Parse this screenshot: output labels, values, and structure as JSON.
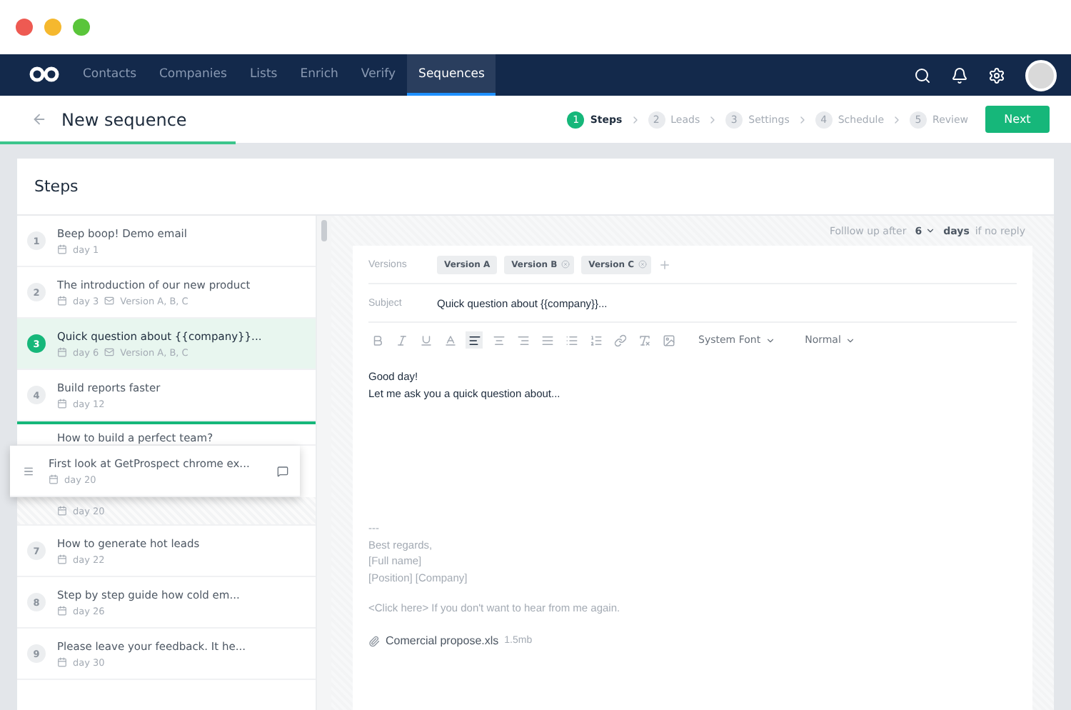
{
  "nav": {
    "tabs": [
      {
        "label": "Contacts",
        "selected": false
      },
      {
        "label": "Companies",
        "selected": false
      },
      {
        "label": "Lists",
        "selected": false
      },
      {
        "label": "Enrich",
        "selected": false
      },
      {
        "label": "Verify",
        "selected": false
      },
      {
        "label": "Sequences",
        "selected": true
      }
    ]
  },
  "header": {
    "title": "New sequence",
    "progress": {
      "level": 0.22
    },
    "wizard": [
      {
        "number": "1",
        "label": "Steps",
        "selected": true
      },
      {
        "number": "2",
        "label": "Leads",
        "selected": false
      },
      {
        "number": "3",
        "label": "Settings",
        "selected": false
      },
      {
        "number": "4",
        "label": "Schedule",
        "selected": false
      },
      {
        "number": "5",
        "label": "Review",
        "selected": false
      }
    ],
    "next_button": "Next"
  },
  "panel_title": "Steps",
  "steps": [
    {
      "kind": "step",
      "number": "1",
      "title": "Beep boop! Demo email",
      "day": "day 1",
      "selected": false
    },
    {
      "kind": "step",
      "number": "2",
      "title": "The introduction of our new product",
      "day": "day 3",
      "versions": "Version A, B, C",
      "selected": false
    },
    {
      "kind": "step",
      "number": "3",
      "title": "Quick question about {{company}}...",
      "day": "day 6",
      "versions": "Version A, B, C",
      "selected": true
    },
    {
      "kind": "step",
      "number": "4",
      "title": "Build reports faster",
      "day": "day 12",
      "selected": false
    },
    {
      "kind": "drop-target",
      "title": "How to build a perfect team?",
      "selected": false
    },
    {
      "kind": "dragged",
      "title": "First look at GetProspect chrome ex...",
      "day": "day 20",
      "selected": false
    },
    {
      "kind": "ghost",
      "day": "day 20",
      "selected": false
    },
    {
      "kind": "step",
      "number": "7",
      "title": "How to generate hot leads",
      "day": "day 22",
      "selected": false
    },
    {
      "kind": "step",
      "number": "8",
      "title": "Step by step guide how cold em...",
      "day": "day 26",
      "selected": false
    },
    {
      "kind": "step",
      "number": "9",
      "title": "Please leave your feedback. It he...",
      "day": "day 30",
      "selected": false
    }
  ],
  "follow_up": {
    "prefix": "Folllow up after",
    "value": "6",
    "unit": "days",
    "suffix": "if no reply"
  },
  "editor": {
    "versions_label": "Versions",
    "versions": [
      {
        "label": "Version A",
        "removable": false
      },
      {
        "label": "Version B",
        "removable": true
      },
      {
        "label": "Version C",
        "removable": true
      }
    ],
    "subject_label": "Subject",
    "subject": "Quick question about {{company}}...",
    "toolbar": [
      {
        "kind": "bold",
        "selected": false
      },
      {
        "kind": "italic",
        "selected": false
      },
      {
        "kind": "underline",
        "selected": false
      },
      {
        "kind": "color",
        "selected": false
      },
      {
        "kind": "align-left",
        "selected": true
      },
      {
        "kind": "align-center",
        "selected": false
      },
      {
        "kind": "align-right",
        "selected": false
      },
      {
        "kind": "justify",
        "selected": false
      },
      {
        "kind": "list",
        "selected": false
      },
      {
        "kind": "ordered-list",
        "selected": false
      },
      {
        "kind": "link",
        "selected": false
      },
      {
        "kind": "clear",
        "selected": false
      },
      {
        "kind": "image",
        "selected": false
      }
    ],
    "font": "System Font",
    "size": "Normal",
    "body": [
      "Good day!",
      "Let me ask you a quick question about..."
    ],
    "signature": [
      "---",
      "Best regards,",
      "[Full name]",
      "[Position] [Company]"
    ],
    "unsubscribe": "<Click here> If you don't want to hear from me again.",
    "attachment": {
      "name": "Comercial propose.xls",
      "size": "1.5mb"
    }
  }
}
